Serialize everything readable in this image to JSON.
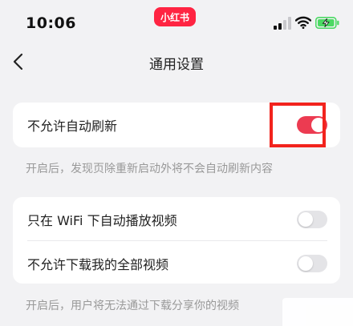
{
  "status_bar": {
    "time": "10:06",
    "brand_label": "小红书",
    "brand_color": "#ff2442",
    "icons": [
      "signal-icon",
      "wifi-icon",
      "battery-charging-icon"
    ]
  },
  "nav": {
    "back_icon": "chevron-left-icon",
    "title": "通用设置"
  },
  "settings": [
    {
      "label": "不允许自动刷新",
      "enabled": true
    },
    {
      "label": "只在 WiFi 下自动播放视频",
      "enabled": false
    },
    {
      "label": "不允许下载我的全部视频",
      "enabled": false
    }
  ],
  "hints": {
    "auto_refresh": "开启后，发现页除重新启动外将不会自动刷新内容",
    "download": "开启后，用户将无法通过下载分享你的视频"
  },
  "colors": {
    "accent": "#ec3b51",
    "annotation": "#f2231d",
    "background": "#f2f2f4"
  }
}
